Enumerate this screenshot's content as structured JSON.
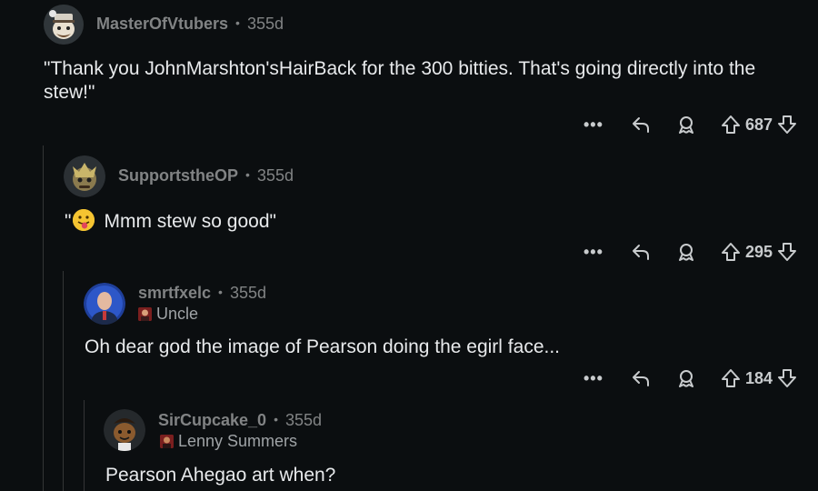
{
  "comments": [
    {
      "username": "MasterOfVtubers",
      "age": "355d",
      "flair": null,
      "body": "\"Thank you JohnMarshton'sHairBack for the 300 bitties. That's going directly into the stew!\"",
      "score": "687"
    },
    {
      "username": "SupportstheOP",
      "age": "355d",
      "flair": null,
      "body_prefix": "\"",
      "body": "Mmm stew so good\"",
      "score": "295"
    },
    {
      "username": "smrtfxelc",
      "age": "355d",
      "flair": "Uncle",
      "body": "Oh dear god the image of Pearson doing the egirl face...",
      "score": "184"
    },
    {
      "username": "SirCupcake_0",
      "age": "355d",
      "flair": "Lenny Summers",
      "body": "Pearson Ahegao art when?"
    }
  ],
  "meta_separator": "•",
  "more_label": "•••",
  "icons": {
    "more": "more-options-icon",
    "reply": "reply-icon",
    "award": "award-icon",
    "upvote": "upvote-arrow-icon",
    "downvote": "downvote-arrow-icon",
    "emoji": "tongue-out-emoji-icon"
  },
  "colors": {
    "background": "#0b0e10",
    "username": "#818384",
    "body_text": "#e8eaec",
    "thread_line": "#343536"
  }
}
